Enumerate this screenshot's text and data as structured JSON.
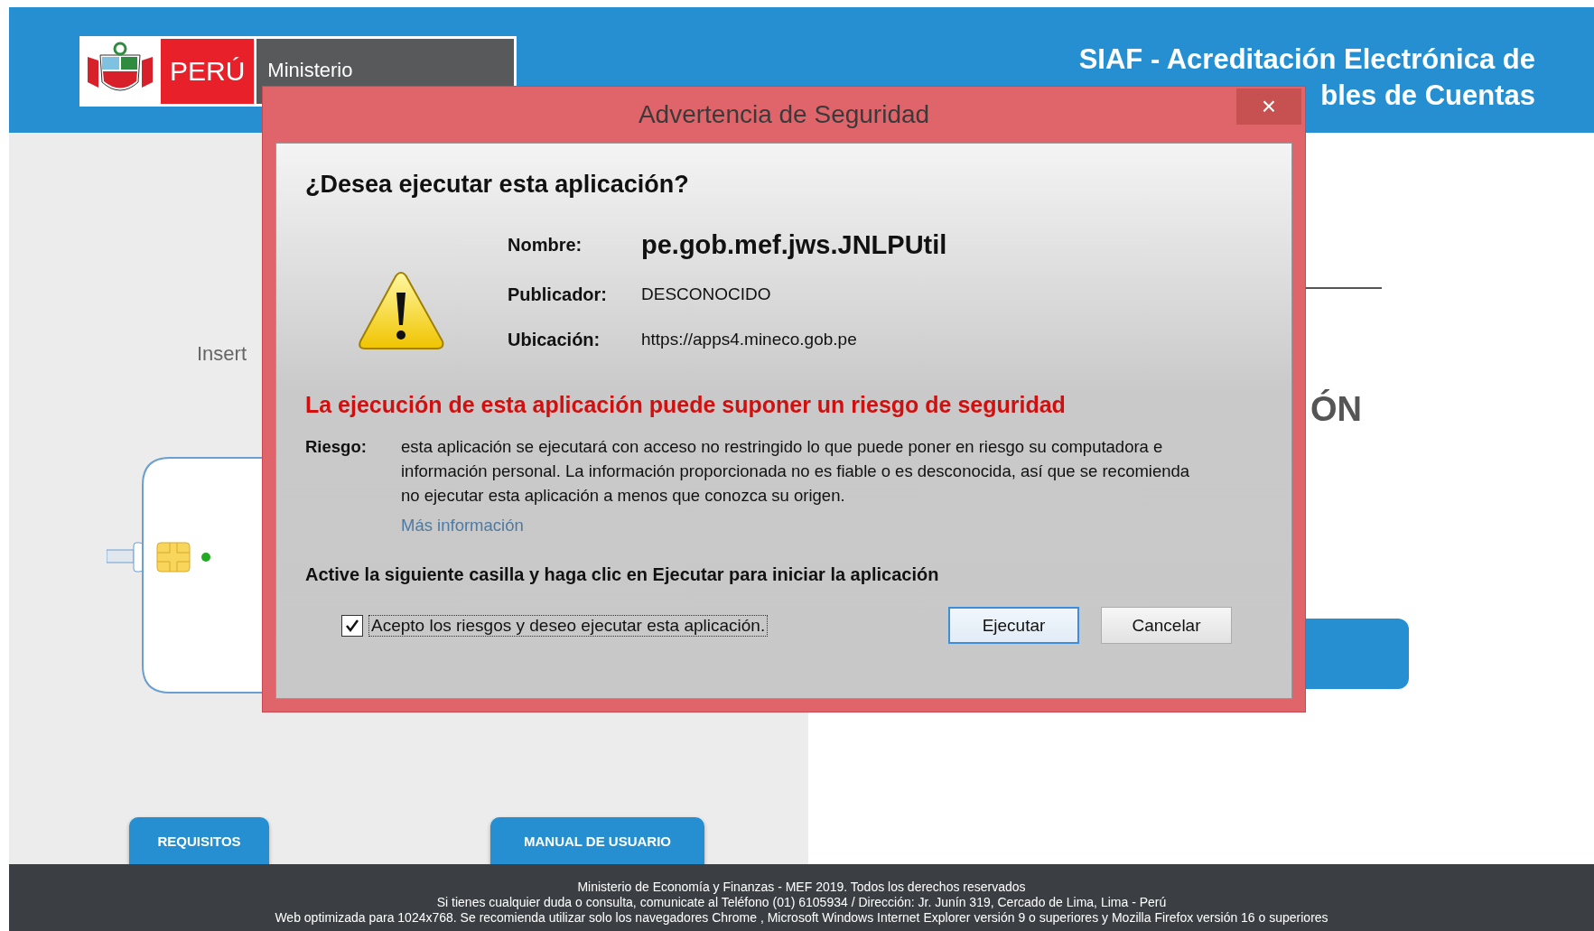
{
  "header": {
    "country": "PERÚ",
    "ministry": "Ministerio",
    "title_lines": [
      "SIAF - Acreditación Electrónica de",
      "bles de Cuentas"
    ]
  },
  "left_panel": {
    "instruction": "Insert",
    "buttons": [
      "REQUISITOS",
      "MANUAL DE USUARIO"
    ]
  },
  "right_panel": {
    "heading": "ÓN"
  },
  "dialog": {
    "title": "Advertencia de Seguridad",
    "close": "×",
    "question": "¿Desea ejecutar esta aplicación?",
    "fields": [
      {
        "label": "Nombre:",
        "value": "pe.gob.mef.jws.JNLPUtil",
        "kind": "emphasis"
      },
      {
        "label": "Publicador:",
        "value": "DESCONOCIDO",
        "kind": "plain"
      },
      {
        "label": "Ubicación:",
        "value": "https://apps4.mineco.gob.pe",
        "kind": "plain"
      }
    ],
    "warning": "La ejecución de esta aplicación puede suponer un riesgo de seguridad",
    "risk_label": "Riesgo:",
    "risk_text": "esta aplicación se ejecutará con acceso no restringido lo que puede poner en riesgo su computadora e información personal. La información proporcionada no es fiable o es desconocida, así que se recomienda no ejecutar esta aplicación a menos que conozca su origen.",
    "more_info": "Más información",
    "instruction": "Active la siguiente casilla y haga clic en Ejecutar para iniciar la aplicación",
    "checkbox": {
      "label": "Acepto los riesgos y deseo ejecutar esta aplicación.",
      "checked": true
    },
    "buttons": [
      {
        "label": "Ejecutar",
        "default": true
      },
      {
        "label": "Cancelar",
        "default": false
      }
    ]
  },
  "footer": {
    "lines": [
      "Ministerio de Economía y Finanzas - MEF 2019. Todos los derechos reservados",
      "Si tienes cualquier duda o consulta, comunicate al Teléfono (01) 6105934 / Dirección: Jr. Junín 319, Cercado de Lima, Lima - Perú",
      "Web optimizada para 1024x768. Se recomienda utilizar solo los navegadores Chrome , Microsoft Windows Internet Explorer versión 9 o superiores y Mozilla Firefox versión 16 o superiores"
    ]
  }
}
